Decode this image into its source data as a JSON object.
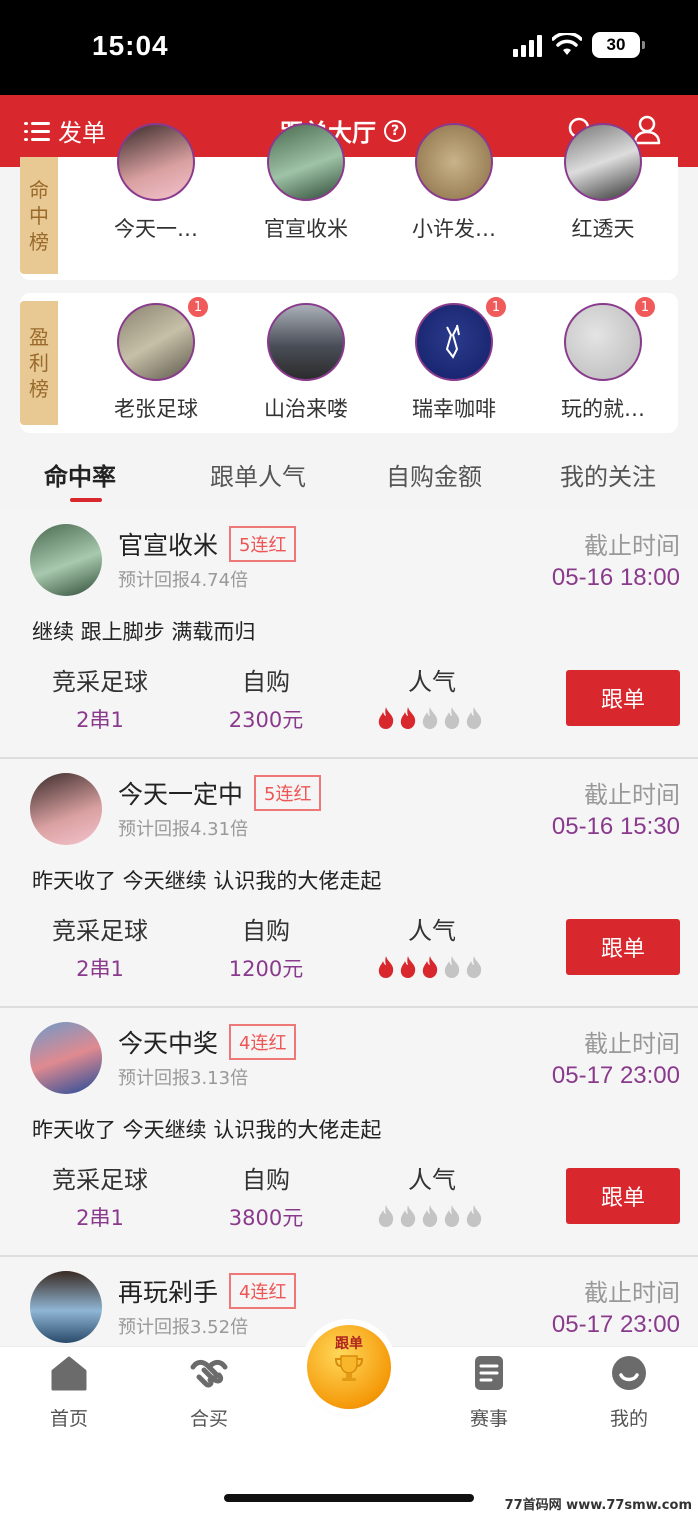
{
  "status_bar": {
    "time": "15:04",
    "battery": "30"
  },
  "header": {
    "left_label": "发单",
    "title": "跟单大厅",
    "help": "?"
  },
  "rank_hit": {
    "tag": [
      "命",
      "中",
      "榜"
    ],
    "users": [
      {
        "name": "今天一…"
      },
      {
        "name": "官宣收米"
      },
      {
        "name": "小许发…"
      },
      {
        "name": "红透天"
      }
    ]
  },
  "rank_profit": {
    "tag": [
      "盈",
      "利",
      "榜"
    ],
    "users": [
      {
        "name": "老张足球",
        "badge": "1"
      },
      {
        "name": "山治来喽",
        "badge": ""
      },
      {
        "name": "瑞幸咖啡",
        "badge": "1"
      },
      {
        "name": "玩的就…",
        "badge": "1"
      }
    ]
  },
  "tabs": [
    "命中率",
    "跟单人气",
    "自购金额",
    "我的关注"
  ],
  "posts": [
    {
      "name": "官宣收米",
      "streak": "5连红",
      "odds": "预计回报4.74倍",
      "deadline_label": "截止时间",
      "deadline": "05-16 18:00",
      "desc": "继续 跟上脚步 满载而归",
      "type_label": "竞采足球",
      "type_value": "2串1",
      "buy_label": "自购",
      "buy_value": "2300元",
      "pop_label": "人气",
      "pop_level": 2,
      "btn": "跟单"
    },
    {
      "name": "今天一定中",
      "streak": "5连红",
      "odds": "预计回报4.31倍",
      "deadline_label": "截止时间",
      "deadline": "05-16 15:30",
      "desc": "昨天收了 今天继续 认识我的大佬走起",
      "type_label": "竞采足球",
      "type_value": "2串1",
      "buy_label": "自购",
      "buy_value": "1200元",
      "pop_label": "人气",
      "pop_level": 3,
      "btn": "跟单"
    },
    {
      "name": "今天中奖",
      "streak": "4连红",
      "odds": "预计回报3.13倍",
      "deadline_label": "截止时间",
      "deadline": "05-17 23:00",
      "desc": "昨天收了 今天继续 认识我的大佬走起",
      "type_label": "竞采足球",
      "type_value": "2串1",
      "buy_label": "自购",
      "buy_value": "3800元",
      "pop_label": "人气",
      "pop_level": 0,
      "btn": "跟单"
    },
    {
      "name": "再玩剁手",
      "streak": "4连红",
      "odds": "预计回报3.52倍",
      "deadline_label": "截止时间",
      "deadline": "05-17 23:00"
    }
  ],
  "bottom_nav": {
    "home": "首页",
    "group": "合买",
    "center": "跟单",
    "events": "赛事",
    "mine": "我的"
  },
  "watermark": "77首码网 www.77smw.com",
  "colors": {
    "primary": "#d8282e",
    "purple": "#8a3a8c",
    "gold_tag": "#e8c993"
  }
}
